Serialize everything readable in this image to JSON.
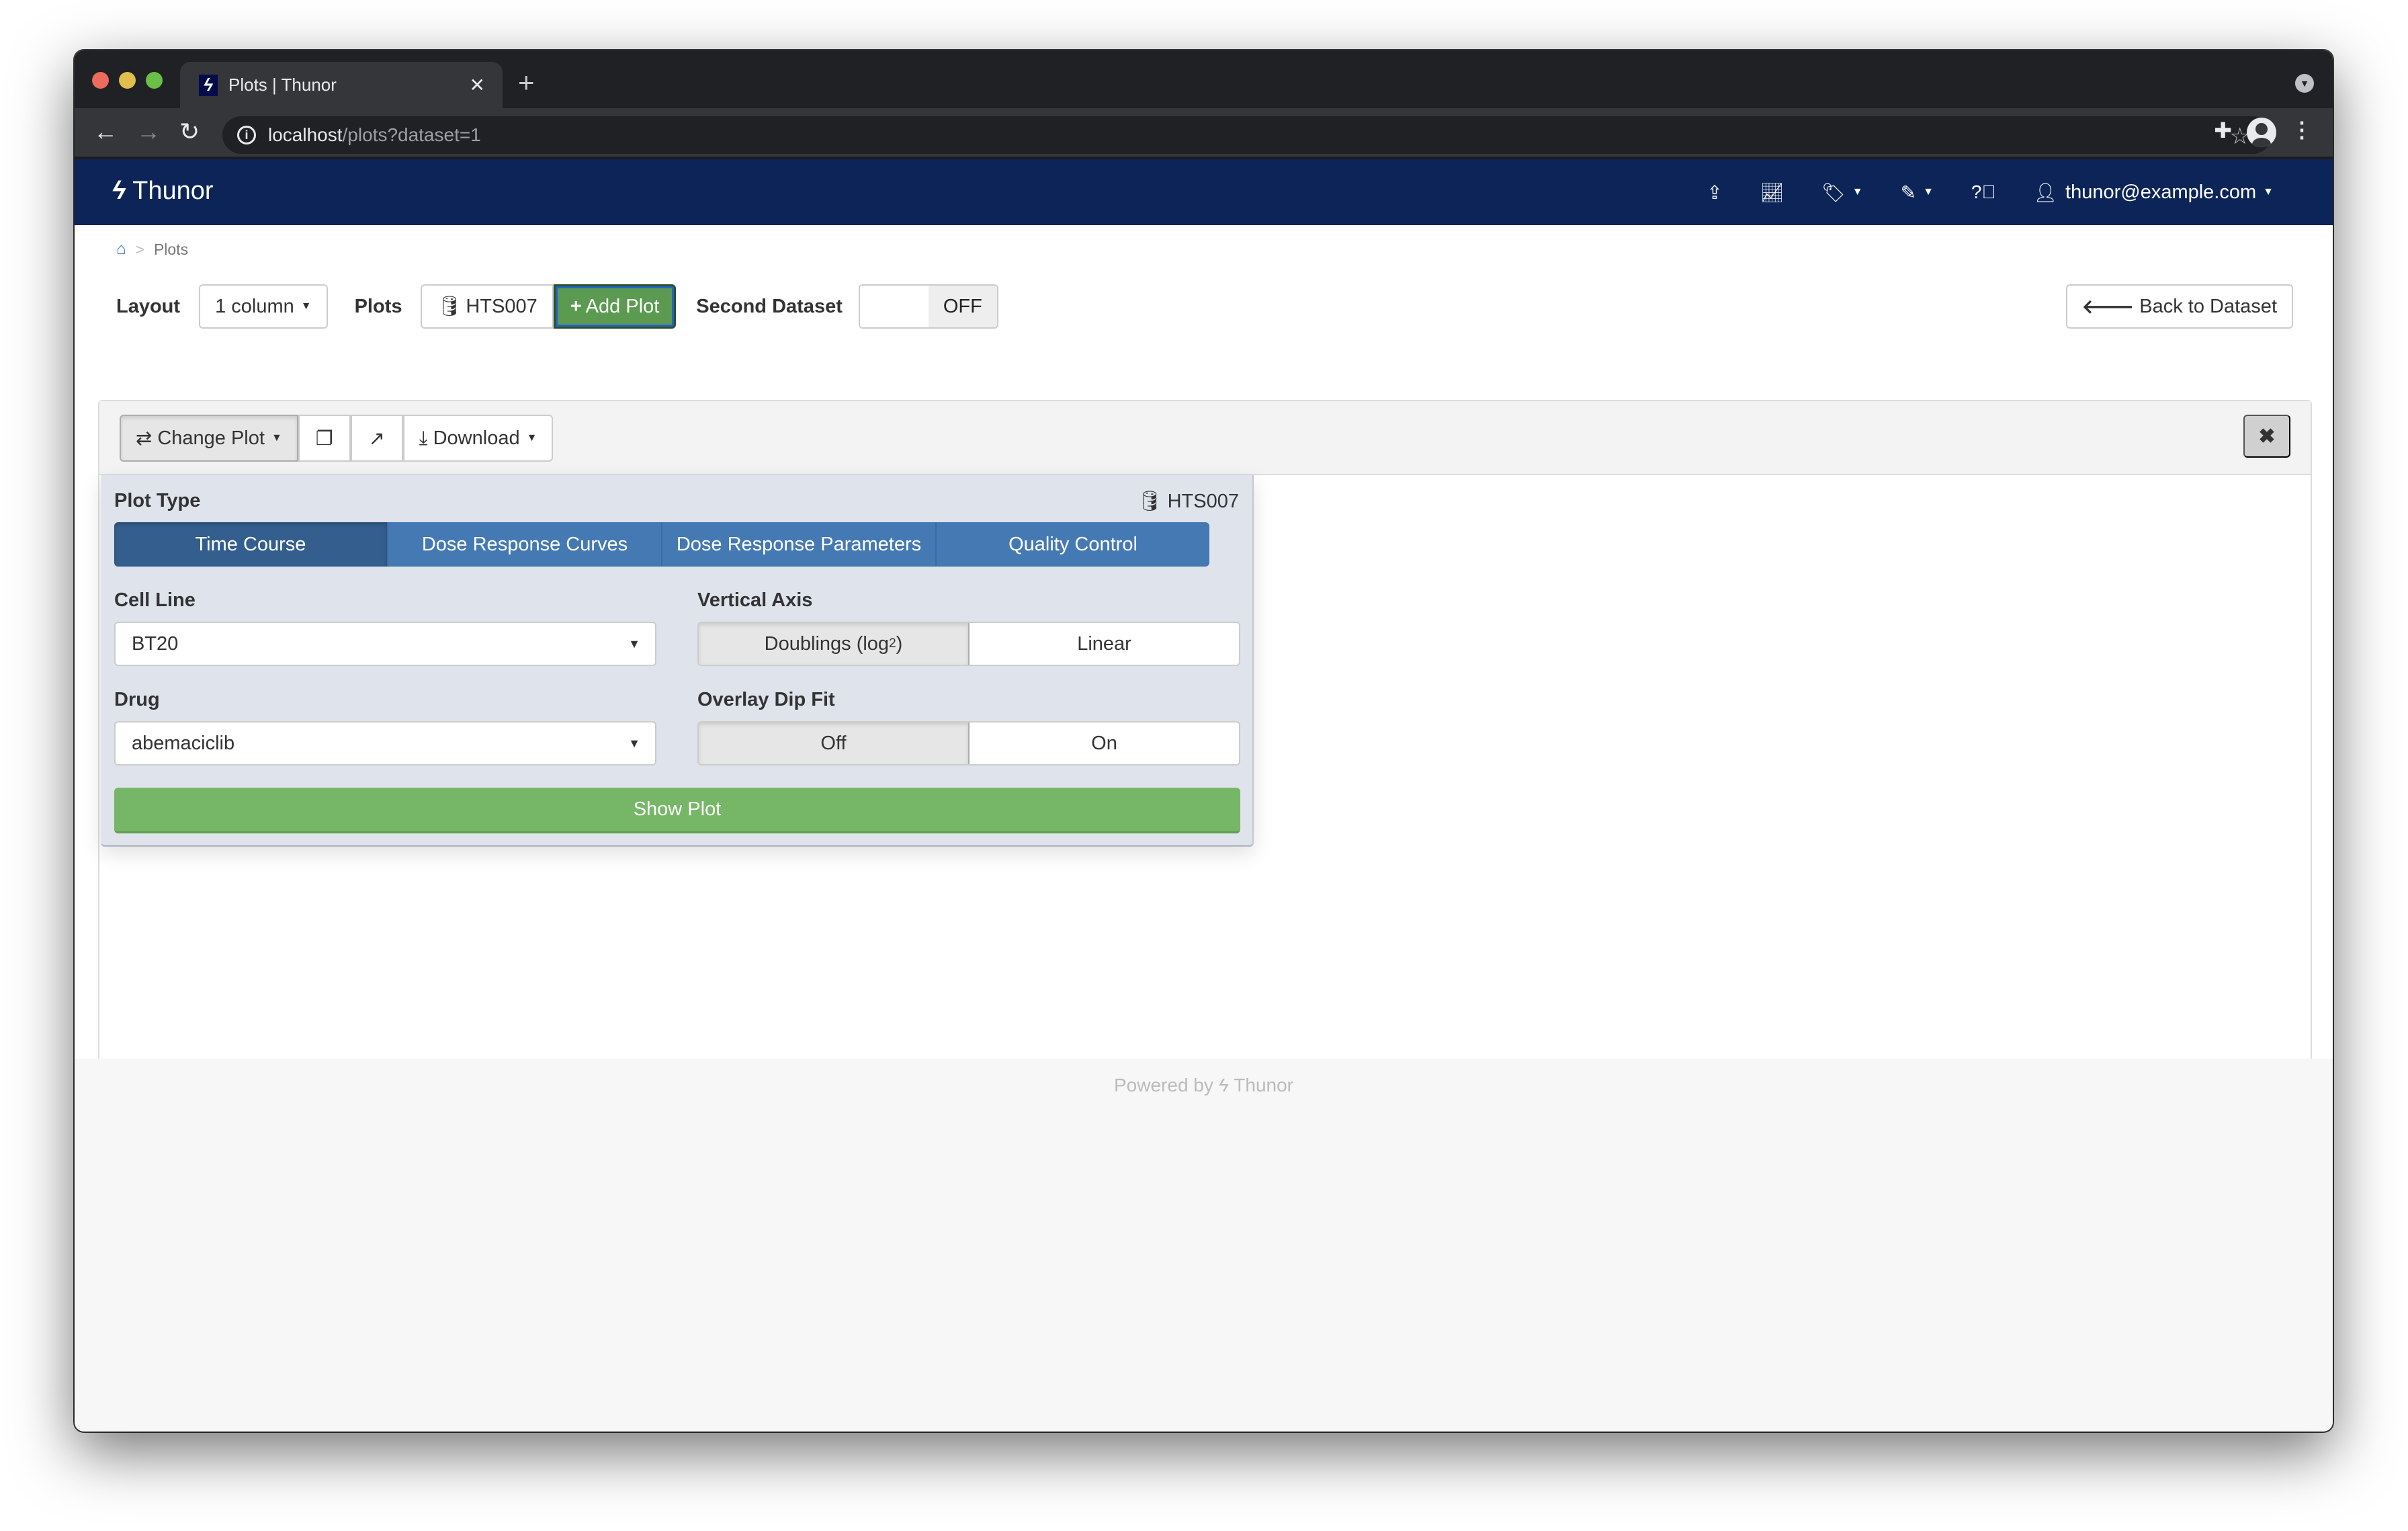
{
  "browser": {
    "tab_title": "Plots | Thunor",
    "tab_favicon": "thunor-bolt-icon",
    "new_tab_label": "+",
    "url_host": "localhost",
    "url_path": "/plots?dataset=1",
    "icons": [
      "back-arrow-icon",
      "forward-arrow-icon",
      "reload-icon",
      "info-icon",
      "star-icon",
      "extensions-icon",
      "profile-icon",
      "menu-icon"
    ]
  },
  "navbar": {
    "brand": "Thunor",
    "brand_color": "#0c2458",
    "icons": [
      "upload-icon",
      "chart-icon",
      "tags-icon",
      "edit-icon",
      "help-icon"
    ],
    "user": "thunor@example.com"
  },
  "breadcrumb": {
    "home_icon": "home-icon",
    "separator": ">",
    "current": "Plots"
  },
  "controls": {
    "layout_label": "Layout",
    "layout_value": "1 column",
    "plots_label": "Plots",
    "dataset_button": "HTS007",
    "add_plot": "Add Plot",
    "second_dataset_label": "Second Dataset",
    "second_dataset_state": "OFF",
    "back_button": "Back to Dataset"
  },
  "plot_panel": {
    "toolbar": {
      "change_plot": "Change Plot",
      "copy_icon": "copy-icon",
      "external_icon": "external-link-icon",
      "download": "Download"
    },
    "close_icon": "close-icon"
  },
  "plot_form": {
    "plot_type_label": "Plot Type",
    "dataset_tag": "HTS007",
    "plot_types": [
      {
        "label": "Time Course",
        "active": true
      },
      {
        "label": "Dose Response Curves",
        "active": false
      },
      {
        "label": "Dose Response Parameters",
        "active": false
      },
      {
        "label": "Quality Control",
        "active": false
      }
    ],
    "cell_line_label": "Cell Line",
    "cell_line_value": "BT20",
    "drug_label": "Drug",
    "drug_value": "abemaciclib",
    "vertical_axis_label": "Vertical Axis",
    "vertical_axis_options": [
      {
        "label": "Doublings (log",
        "sub": "2",
        "suffix": ")",
        "active": true
      },
      {
        "label": "Linear",
        "active": false
      }
    ],
    "overlay_label": "Overlay Dip Fit",
    "overlay_options": [
      {
        "label": "Off",
        "active": true
      },
      {
        "label": "On",
        "active": false
      }
    ],
    "show_plot": "Show Plot",
    "accent_color": "#4479b3",
    "show_plot_color": "#76b767"
  },
  "footer": {
    "prefix": "Powered by",
    "brand": "Thunor"
  }
}
